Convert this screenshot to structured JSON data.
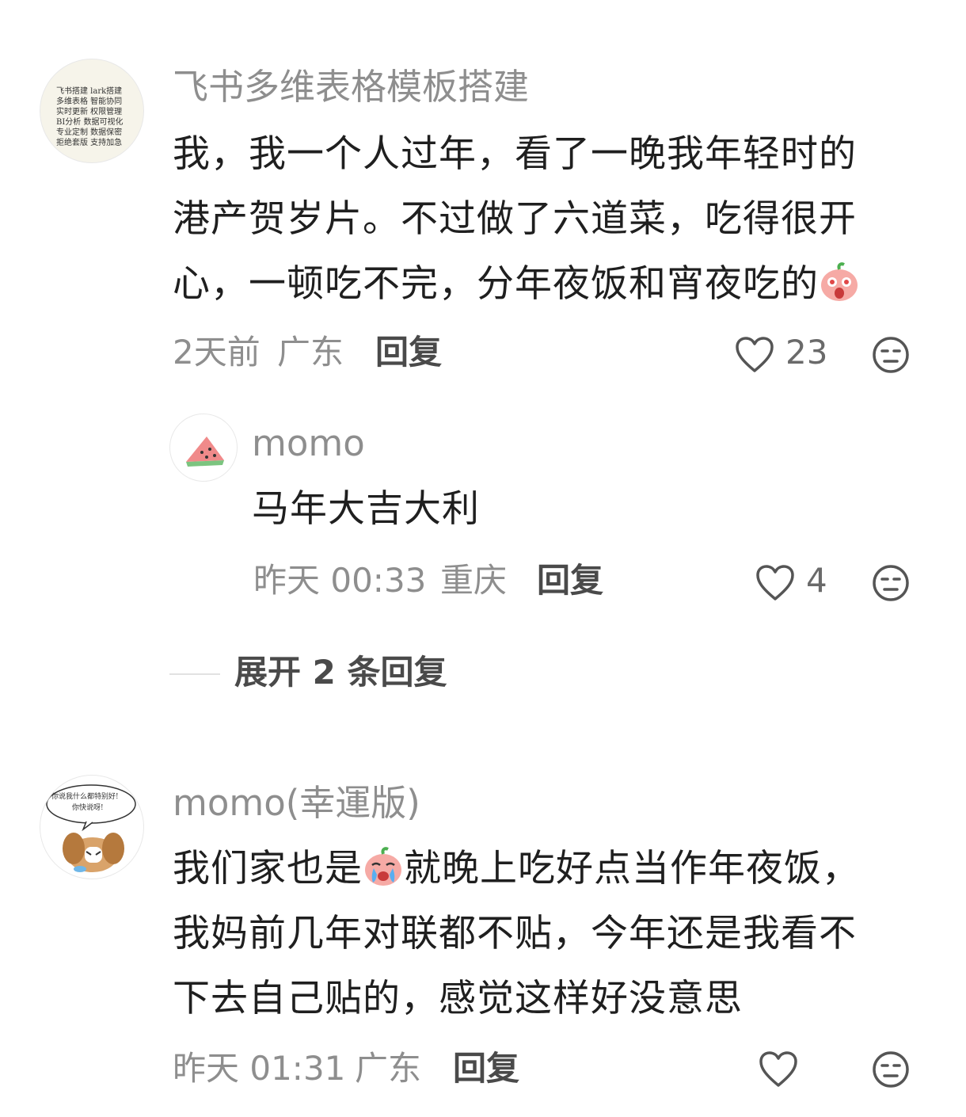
{
  "comments": [
    {
      "username": "飞书多维表格模板搭建",
      "avatar_lines": [
        "飞书搭建 lark搭建",
        "多维表格 智能协同",
        "实时更新 权限管理",
        "BI分析 数据可视化",
        "专业定制 数据保密",
        "拒绝套版 支持加急"
      ],
      "text_lines": [
        "我，我一个人过年，看了一晚我年轻时的",
        "港产贺岁片。不过做了六道菜，吃得很开",
        "心，一顿吃不完，分年夜饭和宵夜吃的"
      ],
      "time": "2天前",
      "location": "广东",
      "reply_label": "回复",
      "like_count": "23",
      "replies": [
        {
          "username": "momo",
          "avatar_icon": "watermelon-icon",
          "text": "马年大吉大利",
          "time": "昨天 00:33",
          "location": "重庆",
          "reply_label": "回复",
          "like_count": "4"
        }
      ],
      "expand_label": "展开 2 条回复"
    },
    {
      "username": "momo(幸運版)",
      "avatar_bubble": [
        "你说我什么都特别好!",
        "你快说呀!"
      ],
      "text_lines": [
        {
          "before": "我们家也是",
          "after": "就晚上吃好点当作年夜饭，"
        },
        "我妈前几年对联都不贴，今年还是我看不",
        "下去自己贴的，感觉这样好没意思"
      ],
      "time": "昨天 01:31",
      "location": "广东",
      "reply_label": "回复",
      "like_count": ""
    }
  ],
  "colors": {
    "text_primary": "#1f1f1f",
    "text_secondary": "#8e8e8e",
    "reply_label": "#4a4a4a",
    "emoji_pink": "#f4a3a0"
  }
}
